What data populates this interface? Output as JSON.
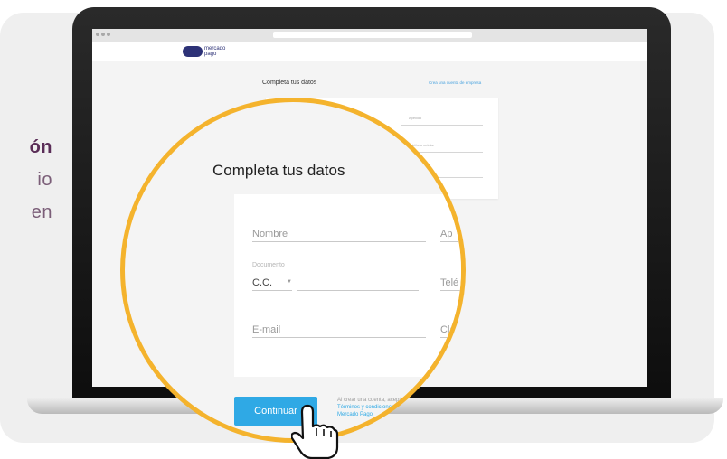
{
  "side_text": {
    "line1": "ón",
    "line2": "io",
    "line3": "en"
  },
  "browser": {
    "tab_titles": [
      "",
      "",
      ""
    ]
  },
  "site": {
    "logo_text_line1": "mercado",
    "logo_text_line2": "pago"
  },
  "background_form": {
    "title": "Completa tus datos",
    "company_link": "Crea una cuenta de empresa",
    "apellido_label": "Apellido",
    "telefono_label": "Teléfono celular"
  },
  "form": {
    "title": "Completa tus datos",
    "nombre_placeholder": "Nombre",
    "apellido_placeholder": "Ap",
    "documento_label": "Documento",
    "documento_type": "C.C.",
    "telefono_placeholder": "Telé",
    "email_placeholder": "E-mail",
    "clave_placeholder": "Clav",
    "continue_label": "Continuar",
    "legal_prefix": "Al crear una cuenta, aceptas",
    "legal_link1": "Términos y condiciones y",
    "legal_link2": "Mercado Pago"
  },
  "colors": {
    "accent": "#2fa9e5",
    "magnifier_ring": "#f4b32d",
    "side_text": "#5a2d57"
  },
  "icons": {
    "cursor": "hand-pointer-icon",
    "dropdown": "caret-down-icon"
  }
}
